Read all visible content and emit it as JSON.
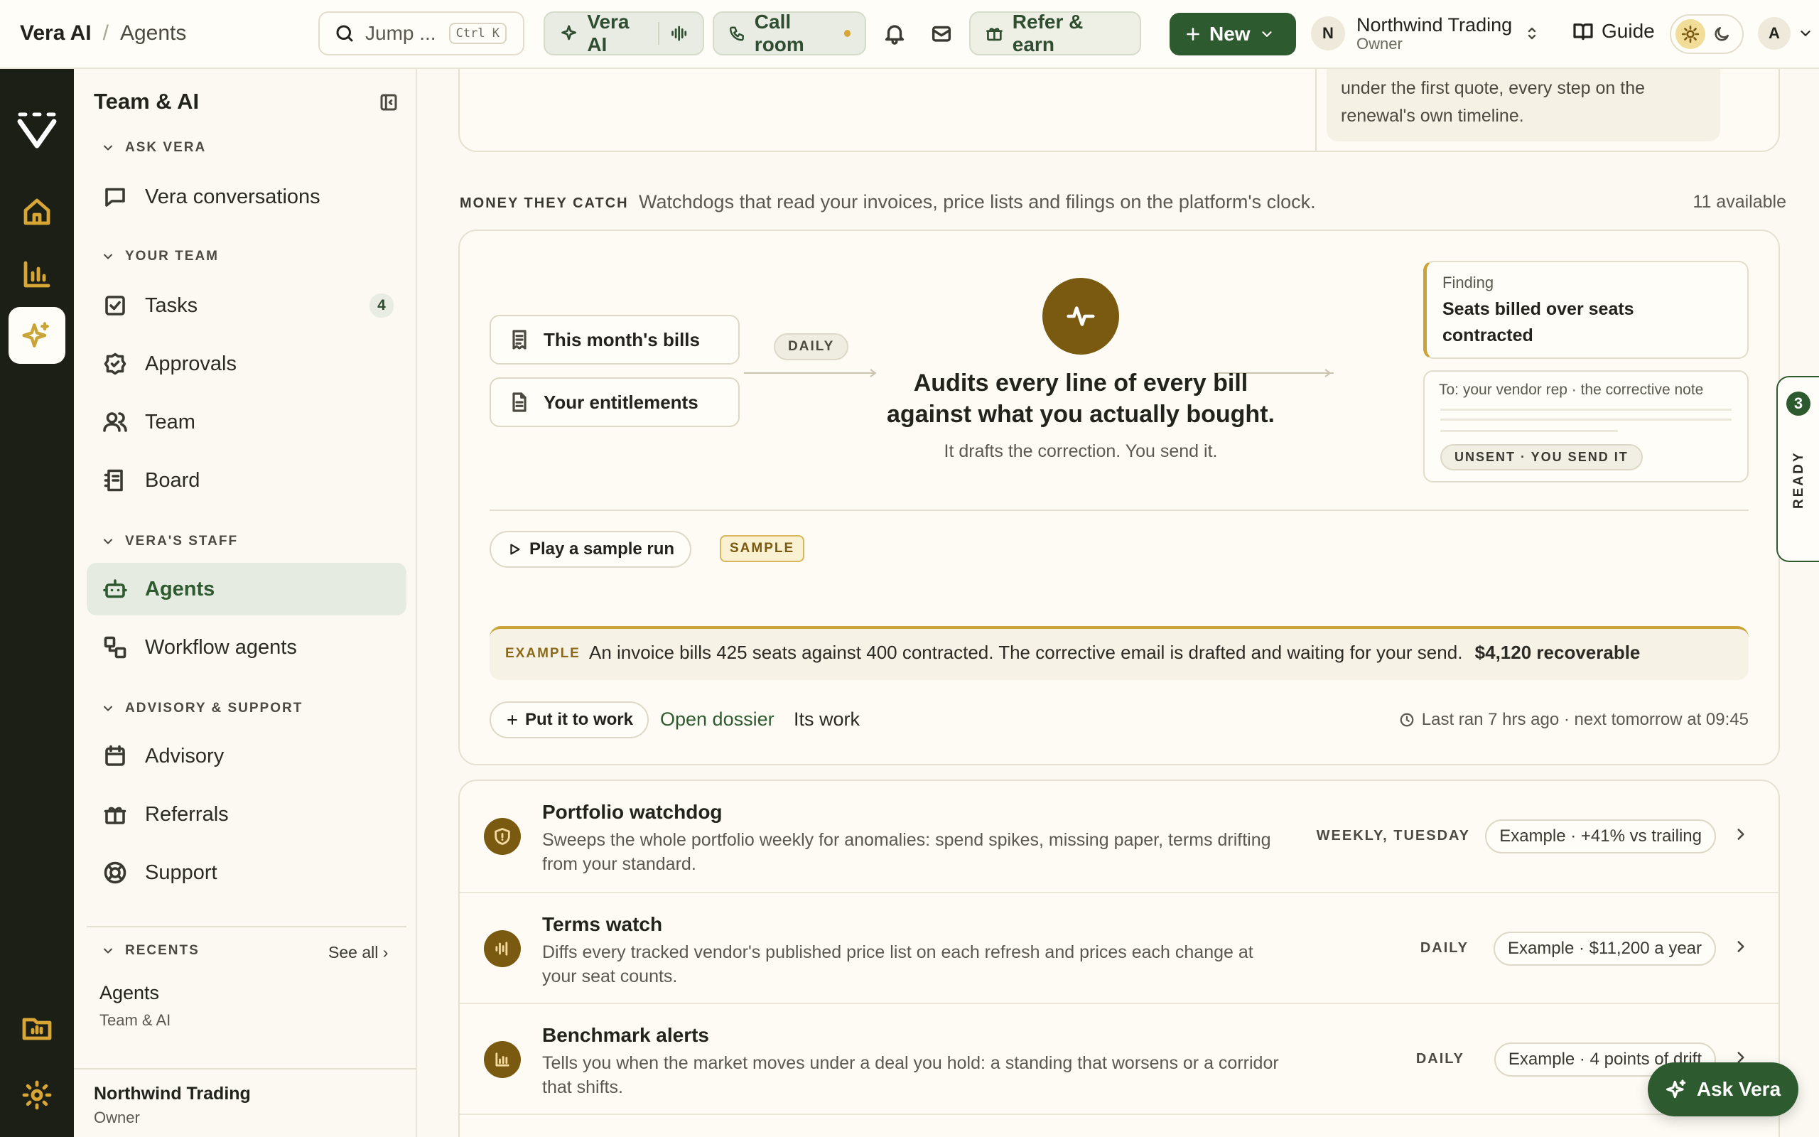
{
  "topbar": {
    "breadcrumb_app": "Vera AI",
    "breadcrumb_sep": "/",
    "breadcrumb_page": "Agents",
    "search_placeholder": "Jump ...",
    "search_shortcut": "Ctrl K",
    "vera_ai_label": "Vera AI",
    "call_room_label": "Call room",
    "refer_label": "Refer & earn",
    "new_label": "New",
    "org_initial": "N",
    "org_name": "Northwind Trading",
    "org_role": "Owner",
    "guide_label": "Guide",
    "user_initial": "A"
  },
  "rail": {
    "icons": [
      "home-icon",
      "bar-chart-icon",
      "sparkle-icon",
      "folder-icon",
      "settings-icon"
    ]
  },
  "sidebar": {
    "title": "Team & AI",
    "sections": {
      "ask_vera": "ASK VERA",
      "your_team": "YOUR TEAM",
      "veras_staff": "VERA'S STAFF",
      "advisory": "ADVISORY & SUPPORT",
      "recents": "RECENTS"
    },
    "items": {
      "vera_conversations": "Vera conversations",
      "tasks": "Tasks",
      "tasks_count": "4",
      "approvals": "Approvals",
      "team": "Team",
      "board": "Board",
      "agents": "Agents",
      "workflow_agents": "Workflow agents",
      "advisory": "Advisory",
      "referrals": "Referrals",
      "support": "Support"
    },
    "see_all": "See all ›",
    "recent_title": "Agents",
    "recent_sub": "Team & AI",
    "footer_name": "Northwind Trading",
    "footer_role": "Owner"
  },
  "top_card": {
    "text": "under the first quote, every step on the renewal's own timeline."
  },
  "money_section": {
    "label": "MONEY THEY CATCH",
    "subtitle": "Watchdogs that read your invoices, price lists and filings on the platform's clock.",
    "count": "11 available"
  },
  "feature": {
    "source1": "This month's bills",
    "source2": "Your entitlements",
    "cadence": "DAILY",
    "headline_line1": "Audits every line of every bill",
    "headline_line2": "against what you actually bought.",
    "subline": "It drafts the correction. You send it.",
    "finding_label": "Finding",
    "finding_title": "Seats billed over seats contracted",
    "note_to": "To: your vendor rep · the corrective note",
    "unsent": "UNSENT · YOU SEND IT",
    "play_label": "Play a sample run",
    "sample_tag": "SAMPLE",
    "example_tag": "EXAMPLE",
    "example_text": "An invoice bills 425 seats against 400 contracted. The corrective email is drafted and waiting for your send.",
    "example_amount": "$4,120 recoverable",
    "put_to_work": "Put it to work",
    "open_dossier": "Open dossier",
    "its_work": "Its work",
    "last_ran": "Last ran 7 hrs ago · next tomorrow at 09:45"
  },
  "ready_tab": {
    "count": "3",
    "label": "READY"
  },
  "agents": [
    {
      "title": "Portfolio watchdog",
      "desc": "Sweeps the whole portfolio weekly for anomalies: spend spikes, missing paper, terms drifting from your standard.",
      "cadence": "WEEKLY, TUESDAY",
      "example": "Example · +41% vs trailing",
      "icon": "shield-icon"
    },
    {
      "title": "Terms watch",
      "desc": "Diffs every tracked vendor's published price list on each refresh and prices each change at your seat counts.",
      "cadence": "DAILY",
      "example": "Example · $11,200 a year",
      "icon": "waveform-icon"
    },
    {
      "title": "Benchmark alerts",
      "desc": "Tells you when the market moves under a deal you hold: a standing that worsens or a corridor that shifts.",
      "cadence": "DAILY",
      "example": "Example · 4 points of drift",
      "icon": "bar-chart-icon"
    }
  ],
  "ask_vera_fab": "Ask Vera",
  "colors": {
    "brand_green": "#2e5a2f",
    "gold": "#7a5a10",
    "accent_gold": "#c9a437",
    "rail_dark": "#1c1f16"
  }
}
